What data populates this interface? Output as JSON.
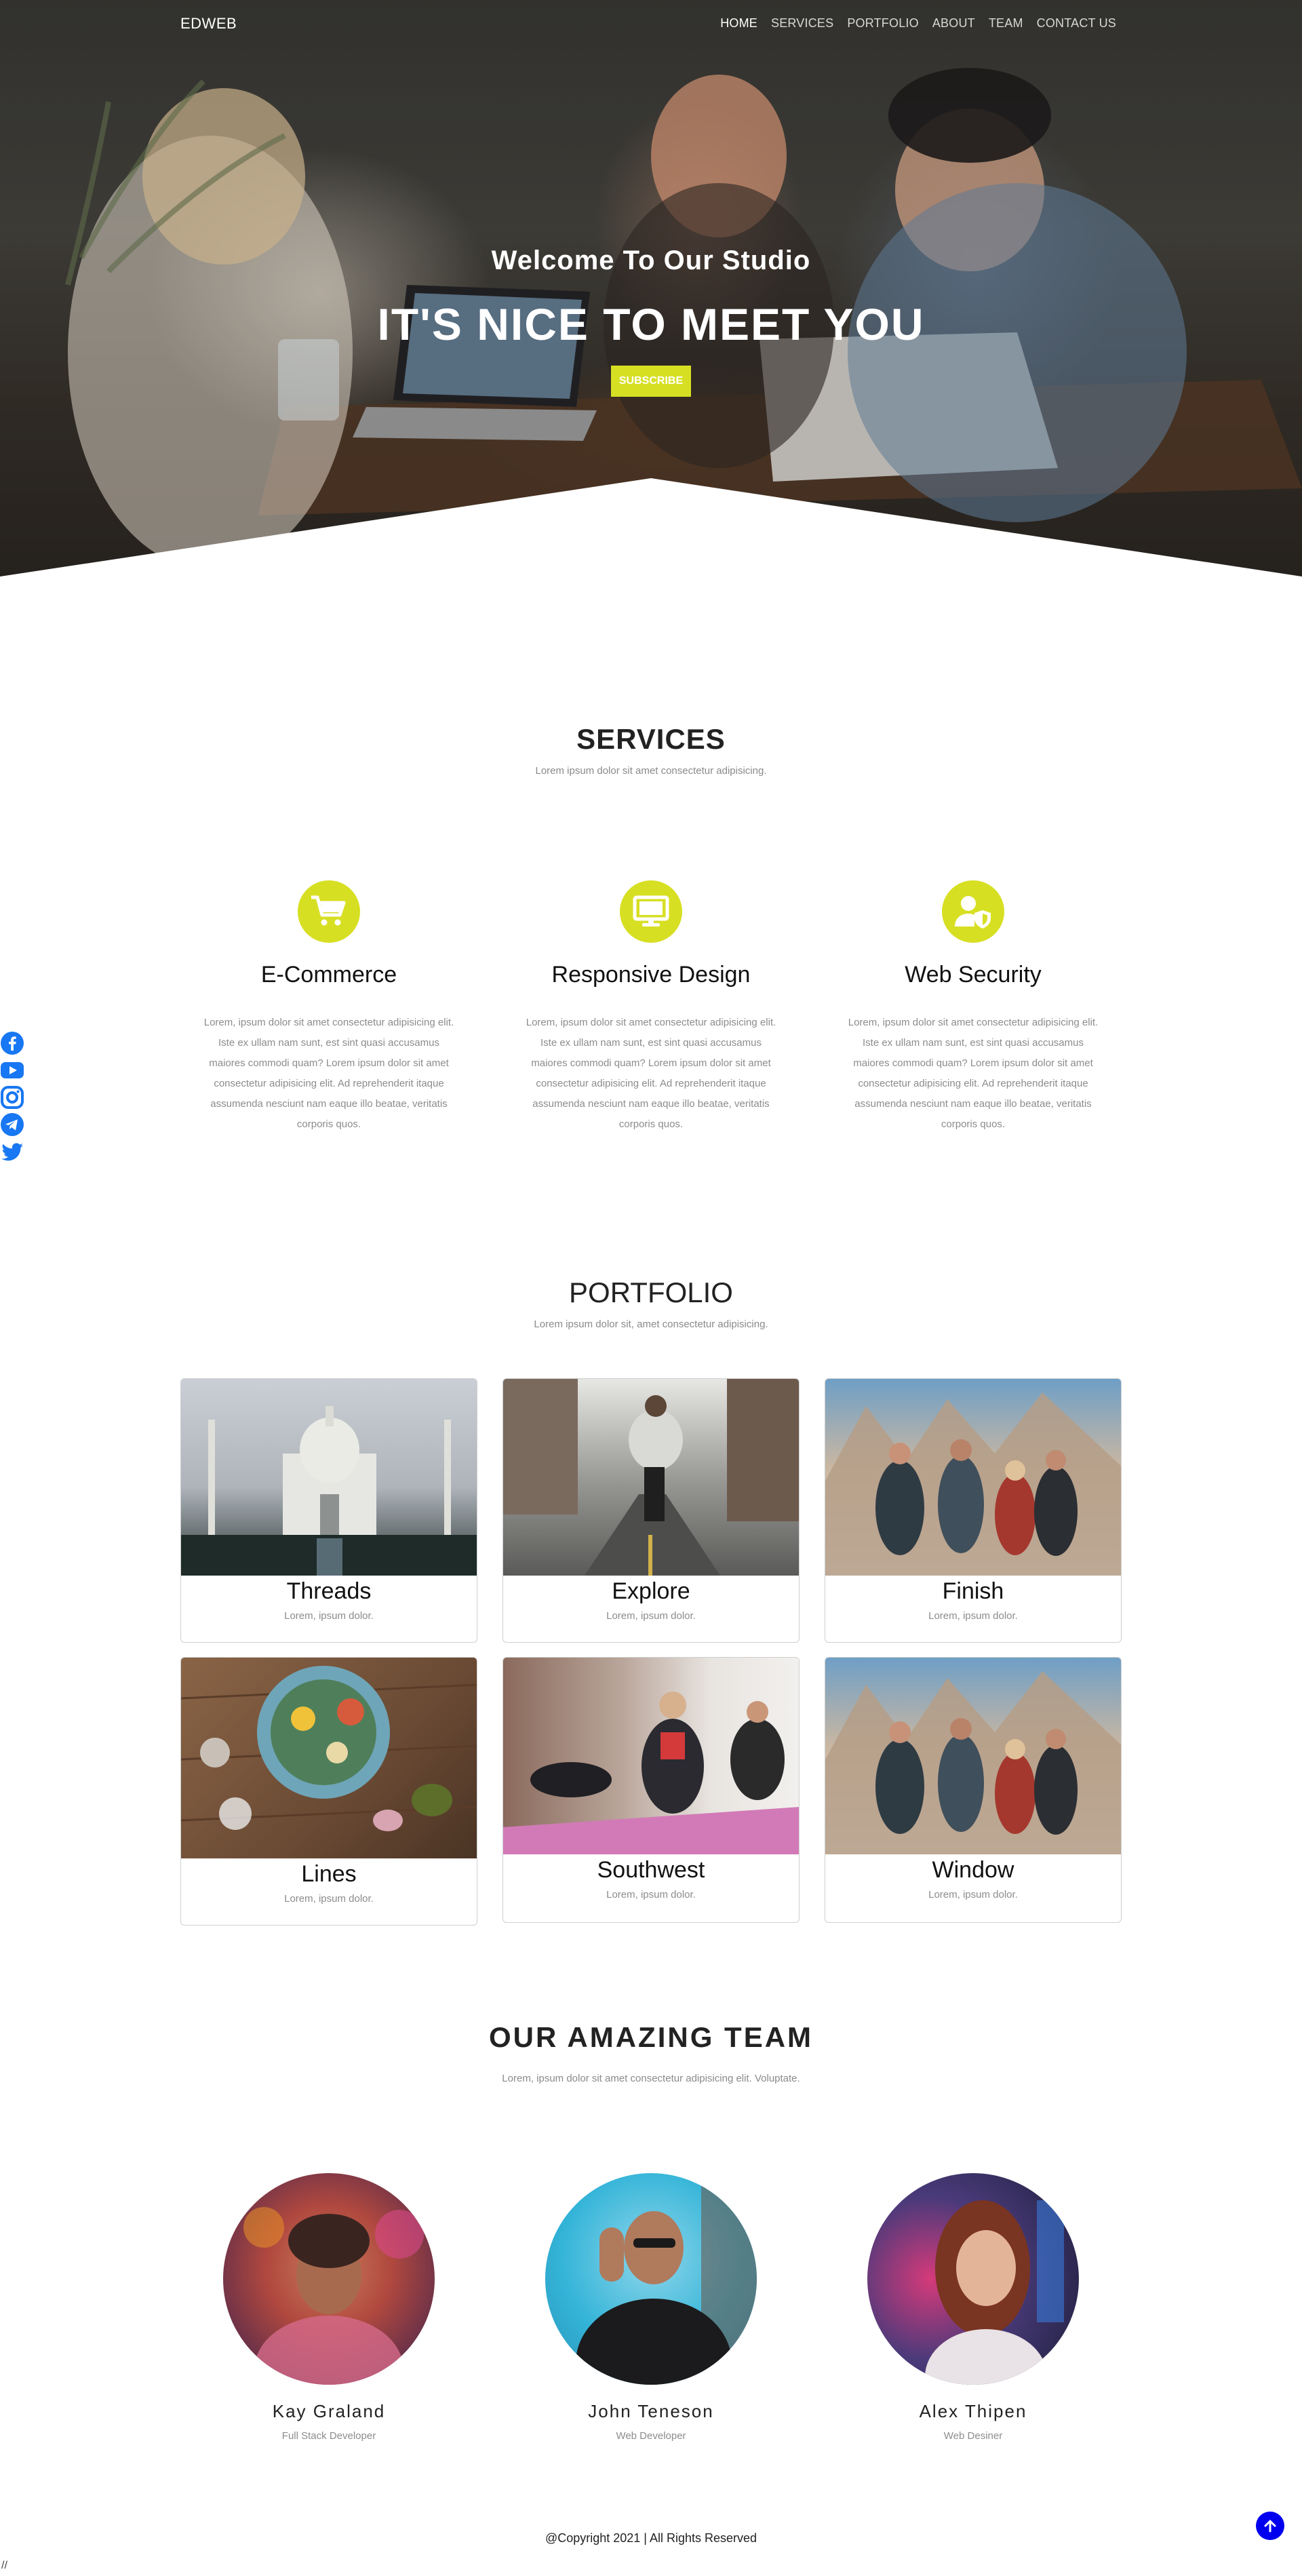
{
  "brand": "EDWEB",
  "nav": [
    "HOME",
    "SERVICES",
    "PORTFOLIO",
    "ABOUT",
    "TEAM",
    "CONTACT US"
  ],
  "hero": {
    "subtitle": "Welcome To Our Studio",
    "title": "IT'S NICE TO MEET YOU",
    "button": "SUBSCRIBE"
  },
  "social": [
    "facebook-icon",
    "youtube-icon",
    "instagram-icon",
    "telegram-icon",
    "twitter-icon"
  ],
  "services": {
    "title": "SERVICES",
    "subtitle": "Lorem ipsum dolor sit amet consectetur adipisicing.",
    "items": [
      {
        "title": "E-Commerce",
        "icon": "cart-icon",
        "text": "Lorem, ipsum dolor sit amet consectetur adipisicing elit. Iste ex ullam nam sunt, est sint quasi accusamus maiores commodi quam? Lorem ipsum dolor sit amet consectetur adipisicing elit. Ad reprehenderit itaque assumenda nesciunt nam eaque illo beatae, veritatis corporis quos."
      },
      {
        "title": "Responsive Design",
        "icon": "monitor-icon",
        "text": "Lorem, ipsum dolor sit amet consectetur adipisicing elit. Iste ex ullam nam sunt, est sint quasi accusamus maiores commodi quam? Lorem ipsum dolor sit amet consectetur adipisicing elit. Ad reprehenderit itaque assumenda nesciunt nam eaque illo beatae, veritatis corporis quos."
      },
      {
        "title": "Web Security",
        "icon": "user-shield-icon",
        "text": "Lorem, ipsum dolor sit amet consectetur adipisicing elit. Iste ex ullam nam sunt, est sint quasi accusamus maiores commodi quam? Lorem ipsum dolor sit amet consectetur adipisicing elit. Ad reprehenderit itaque assumenda nesciunt nam eaque illo beatae, veritatis corporis quos."
      }
    ]
  },
  "portfolio": {
    "title": "PORTFOLIO",
    "subtitle": "Lorem ipsum dolor sit, amet consectetur adipisicing.",
    "items": [
      {
        "title": "Threads",
        "subtitle": "Lorem, ipsum dolor."
      },
      {
        "title": "Explore",
        "subtitle": "Lorem, ipsum dolor."
      },
      {
        "title": "Finish",
        "subtitle": "Lorem, ipsum dolor."
      },
      {
        "title": "Lines",
        "subtitle": "Lorem, ipsum dolor."
      },
      {
        "title": "Southwest",
        "subtitle": "Lorem, ipsum dolor."
      },
      {
        "title": "Window",
        "subtitle": "Lorem, ipsum dolor."
      }
    ]
  },
  "team": {
    "title": "OUR AMAZING TEAM",
    "subtitle": "Lorem, ipsum dolor sit amet consectetur adipisicing elit. Voluptate.",
    "members": [
      {
        "name": "Kay Graland",
        "role": "Full Stack Developer"
      },
      {
        "name": "John Teneson",
        "role": "Web Developer"
      },
      {
        "name": "Alex Thipen",
        "role": "Web Desiner"
      }
    ]
  },
  "footer": {
    "copyright": "@Copyright 2021 | All Rights Reserved",
    "stray": "//"
  },
  "colors": {
    "accent": "#d7df23",
    "social": "#1877f2",
    "top_button": "#0000ee"
  }
}
